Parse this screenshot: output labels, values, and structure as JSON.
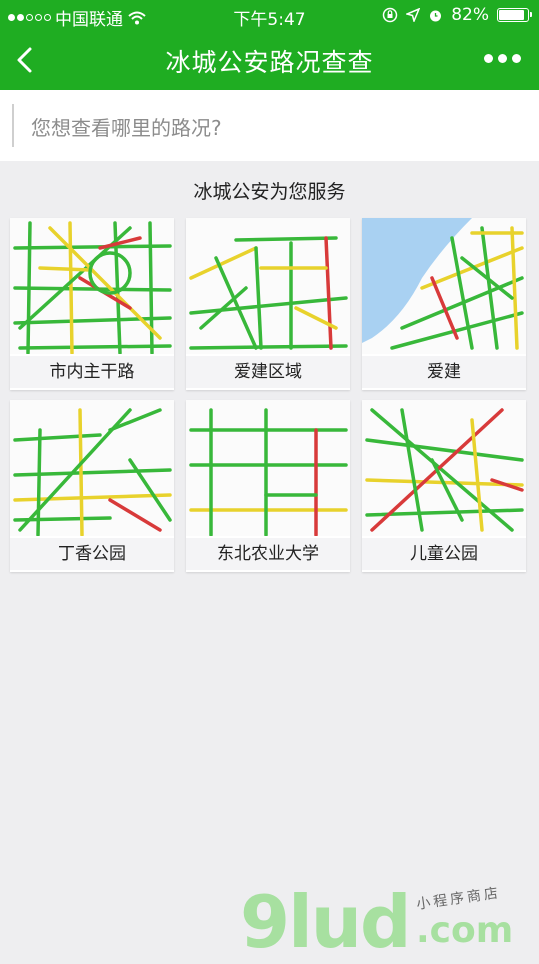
{
  "status_bar": {
    "carrier": "中国联通",
    "time": "下午5:47",
    "battery": "82%"
  },
  "nav": {
    "title": "冰城公安路况查查"
  },
  "search": {
    "placeholder": "您想查看哪里的路况?"
  },
  "section_title": "冰城公安为您服务",
  "cards": [
    {
      "label": "市内主干路"
    },
    {
      "label": "爱建区域"
    },
    {
      "label": "爱建"
    },
    {
      "label": "丁香公园"
    },
    {
      "label": "东北农业大学"
    },
    {
      "label": "儿童公园"
    }
  ],
  "watermark": {
    "logo": "9lud",
    "small": "小程序商店",
    "domain": ".com"
  },
  "colors": {
    "brand_green": "#1fad22",
    "road_green": "#38b83a",
    "road_yellow": "#e8d22c",
    "road_red": "#d83a3a",
    "water_blue": "#a9d1f2"
  }
}
